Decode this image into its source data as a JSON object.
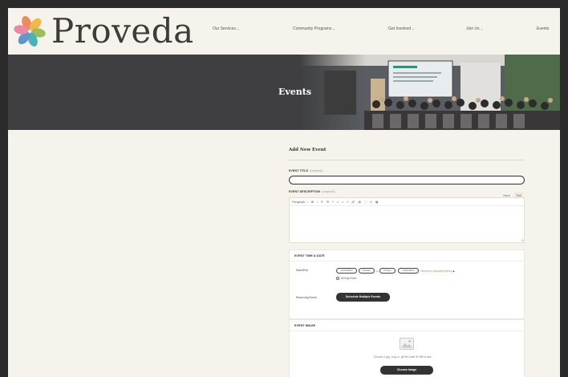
{
  "brand": {
    "name": "Proveda",
    "colors": {
      "petal_orange": "#ee8b5c",
      "petal_teal": "#48b5b0",
      "petal_pink": "#e98aa0",
      "petal_green": "#9bbd5b",
      "petal_blue": "#5f96cc",
      "petal_yellow": "#f2b84b"
    }
  },
  "nav": {
    "items": [
      {
        "label": "Our Services",
        "has_dropdown": true
      },
      {
        "label": "Community Programs",
        "has_dropdown": true
      },
      {
        "label": "Get Involved",
        "has_dropdown": true
      },
      {
        "label": "Join Us",
        "has_dropdown": true
      },
      {
        "label": "Events",
        "has_dropdown": false
      }
    ],
    "caret": "⌄"
  },
  "hero": {
    "title": "Events",
    "bg_color": "#3f3f41"
  },
  "form": {
    "title": "Add New Event",
    "event_title": {
      "label": "EVENT TITLE",
      "required": "(required)",
      "value": "",
      "placeholder": ""
    },
    "event_description": {
      "label": "EVENT DESCRIPTION",
      "required": "(required)",
      "tabs": [
        "Visual",
        "Text"
      ],
      "toolbar": {
        "format": "Paragraph",
        "caret": "⌄",
        "buttons": [
          "B",
          "I",
          "☷",
          "☰",
          "❝",
          "≡",
          "≡",
          "≡",
          "🔗",
          "▤",
          "⬚",
          "✕",
          "▦"
        ]
      },
      "resize_glyph": "◢"
    },
    "time_date": {
      "heading": "EVENT TIME & DATE",
      "start_end_label": "Start/End",
      "start_date": "12/09/2024",
      "start_time": "8:00am",
      "to_text": "to",
      "end_time": "5:00pm",
      "end_date": "12/09/2024",
      "timezone": "Timezone: Australia/Sydney",
      "timezone_mark": "◆",
      "all_day_label": "All Day Event",
      "recurring_label": "Recurring Event",
      "schedule_button": "Schedule Multiple Events"
    },
    "event_image": {
      "heading": "EVENT IMAGE",
      "icon": "image-placeholder-icon",
      "hint": "Choose a .jpg, .png, or .gif file under 50 MB in size.",
      "choose_button": "Choose Image"
    }
  }
}
